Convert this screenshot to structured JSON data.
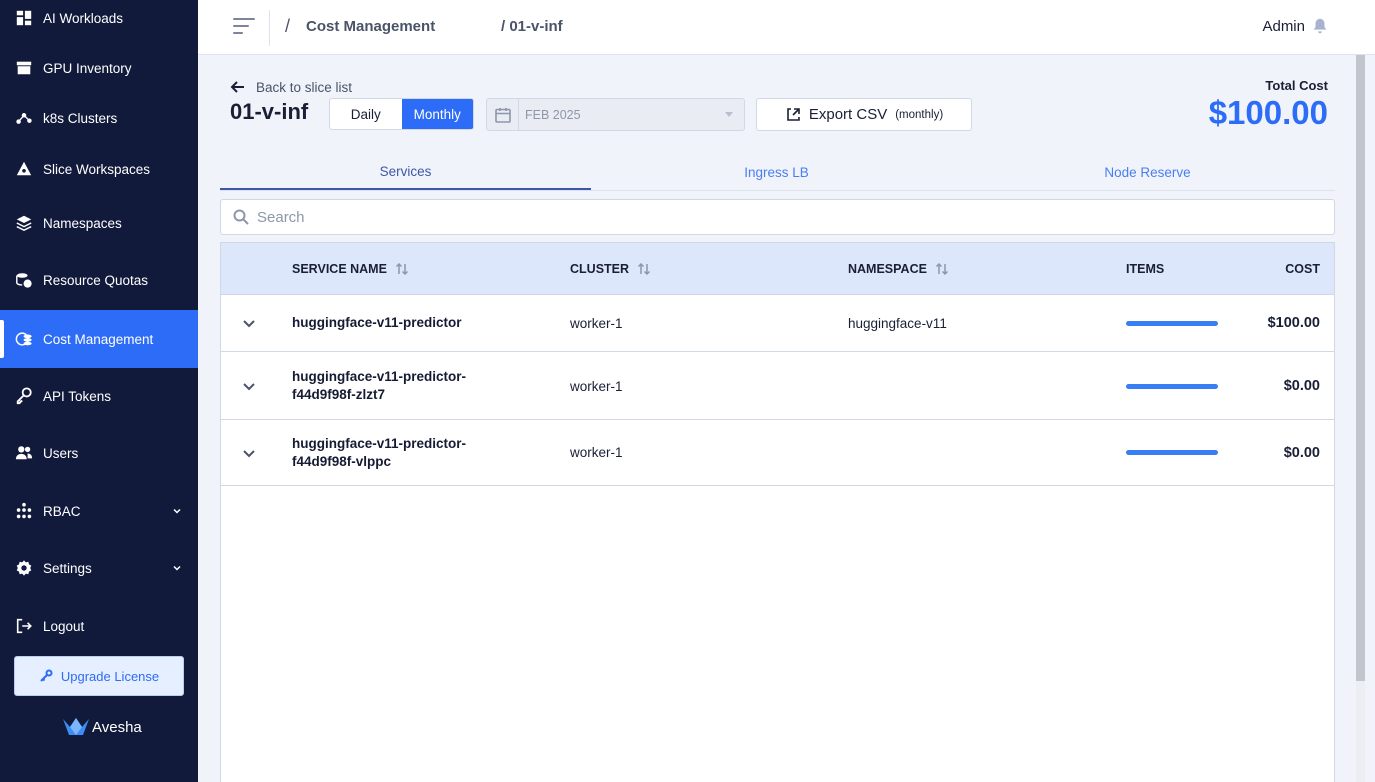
{
  "sidebar": {
    "items": [
      {
        "label": "AI Workloads",
        "icon": "dashboard-icon"
      },
      {
        "label": "GPU Inventory",
        "icon": "archive-icon"
      },
      {
        "label": "k8s Clusters",
        "icon": "cluster-icon"
      },
      {
        "label": "Slice Workspaces",
        "icon": "slice-icon"
      },
      {
        "label": "Namespaces",
        "icon": "layers-icon"
      },
      {
        "label": "Resource Quotas",
        "icon": "quota-icon"
      },
      {
        "label": "Cost Management",
        "icon": "cost-icon",
        "active": true
      },
      {
        "label": "API Tokens",
        "icon": "key-icon"
      },
      {
        "label": "Users",
        "icon": "users-icon"
      },
      {
        "label": "RBAC",
        "icon": "rbac-icon",
        "expandable": true
      },
      {
        "label": "Settings",
        "icon": "gear-icon",
        "expandable": true
      },
      {
        "label": "Logout",
        "icon": "logout-icon"
      }
    ],
    "upgrade_label": "Upgrade License",
    "brand": "Avesha"
  },
  "header": {
    "breadcrumb_1": "Cost Management",
    "breadcrumb_2": "/ 01-v-inf",
    "user": "Admin"
  },
  "main": {
    "back_label": "Back to slice list",
    "title": "01-v-inf",
    "toggle": {
      "daily": "Daily",
      "monthly": "Monthly",
      "selected": "Monthly"
    },
    "date": "FEB 2025",
    "export_label": "Export CSV",
    "export_suffix": "(monthly)",
    "total_label": "Total Cost",
    "total_value": "$100.00",
    "tabs": [
      "Services",
      "Ingress LB",
      "Node Reserve"
    ],
    "active_tab": "Services",
    "search_placeholder": "Search"
  },
  "table": {
    "columns": [
      "SERVICE NAME",
      "CLUSTER",
      "NAMESPACE",
      "ITEMS",
      "COST"
    ],
    "rows": [
      {
        "service": "huggingface-v11-predictor",
        "cluster": "worker-1",
        "namespace": "huggingface-v11",
        "items_fill": 1.0,
        "cost": "$100.00"
      },
      {
        "service": "huggingface-v11-predictor-f44d9f98f-zlzt7",
        "service_line1": "huggingface-v11-predictor-",
        "service_line2": "f44d9f98f-zlzt7",
        "cluster": "worker-1",
        "namespace": "",
        "items_fill": 1.0,
        "cost": "$0.00"
      },
      {
        "service": "huggingface-v11-predictor-f44d9f98f-vlppc",
        "service_line1": "huggingface-v11-predictor-",
        "service_line2": "f44d9f98f-vlppc",
        "cluster": "worker-1",
        "namespace": "",
        "items_fill": 1.0,
        "cost": "$0.00"
      }
    ]
  },
  "colors": {
    "sidebar_bg": "#121a3b",
    "accent": "#2d6cf6",
    "table_header_bg": "#dce7fb"
  }
}
